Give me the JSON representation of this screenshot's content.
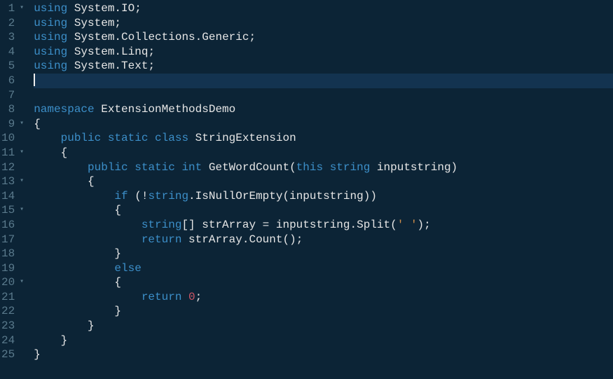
{
  "lines": [
    {
      "n": 1,
      "fold": true,
      "tokens": [
        [
          "k",
          "using "
        ],
        [
          "ns",
          "System"
        ],
        [
          "pn",
          "."
        ],
        [
          "ns",
          "IO"
        ],
        [
          "pn",
          ";"
        ]
      ]
    },
    {
      "n": 2,
      "fold": false,
      "tokens": [
        [
          "k",
          "using "
        ],
        [
          "ns",
          "System"
        ],
        [
          "pn",
          ";"
        ]
      ]
    },
    {
      "n": 3,
      "fold": false,
      "tokens": [
        [
          "k",
          "using "
        ],
        [
          "ns",
          "System"
        ],
        [
          "pn",
          "."
        ],
        [
          "ns",
          "Collections"
        ],
        [
          "pn",
          "."
        ],
        [
          "ns",
          "Generic"
        ],
        [
          "pn",
          ";"
        ]
      ]
    },
    {
      "n": 4,
      "fold": false,
      "tokens": [
        [
          "k",
          "using "
        ],
        [
          "ns",
          "System"
        ],
        [
          "pn",
          "."
        ],
        [
          "ns",
          "Linq"
        ],
        [
          "pn",
          ";"
        ]
      ]
    },
    {
      "n": 5,
      "fold": false,
      "tokens": [
        [
          "k",
          "using "
        ],
        [
          "ns",
          "System"
        ],
        [
          "pn",
          "."
        ],
        [
          "ns",
          "Text"
        ],
        [
          "pn",
          ";"
        ]
      ]
    },
    {
      "n": 6,
      "fold": false,
      "current": true,
      "cursor": true,
      "tokens": []
    },
    {
      "n": 7,
      "fold": false,
      "tokens": []
    },
    {
      "n": 8,
      "fold": false,
      "tokens": [
        [
          "k",
          "namespace "
        ],
        [
          "cl",
          "ExtensionMethodsDemo"
        ]
      ]
    },
    {
      "n": 9,
      "fold": true,
      "tokens": [
        [
          "pn",
          "{"
        ]
      ]
    },
    {
      "n": 10,
      "fold": false,
      "indent": 1,
      "tokens": [
        [
          "k",
          "public "
        ],
        [
          "k",
          "static "
        ],
        [
          "k",
          "class "
        ],
        [
          "cl",
          "StringExtension"
        ]
      ]
    },
    {
      "n": 11,
      "fold": true,
      "indent": 1,
      "tokens": [
        [
          "pn",
          "{"
        ]
      ]
    },
    {
      "n": 12,
      "fold": false,
      "indent": 2,
      "tokens": [
        [
          "k",
          "public "
        ],
        [
          "k",
          "static "
        ],
        [
          "ty",
          "int "
        ],
        [
          "fn",
          "GetWordCount"
        ],
        [
          "pn",
          "("
        ],
        [
          "k",
          "this "
        ],
        [
          "ty",
          "string "
        ],
        [
          "id",
          "inputstring"
        ],
        [
          "pn",
          ")"
        ]
      ]
    },
    {
      "n": 13,
      "fold": true,
      "indent": 2,
      "tokens": [
        [
          "pn",
          "{"
        ]
      ]
    },
    {
      "n": 14,
      "fold": false,
      "indent": 3,
      "tokens": [
        [
          "k",
          "if "
        ],
        [
          "pn",
          "(!"
        ],
        [
          "ty",
          "string"
        ],
        [
          "pn",
          "."
        ],
        [
          "fn",
          "IsNullOrEmpty"
        ],
        [
          "pn",
          "("
        ],
        [
          "id",
          "inputstring"
        ],
        [
          "pn",
          "))"
        ]
      ]
    },
    {
      "n": 15,
      "fold": true,
      "indent": 3,
      "tokens": [
        [
          "pn",
          "{"
        ]
      ]
    },
    {
      "n": 16,
      "fold": false,
      "indent": 4,
      "tokens": [
        [
          "ty",
          "string"
        ],
        [
          "pn",
          "[] "
        ],
        [
          "id",
          "strArray"
        ],
        [
          "op",
          " = "
        ],
        [
          "id",
          "inputstring"
        ],
        [
          "pn",
          "."
        ],
        [
          "fn",
          "Split"
        ],
        [
          "pn",
          "("
        ],
        [
          "str",
          "' '"
        ],
        [
          "pn",
          ");"
        ]
      ]
    },
    {
      "n": 17,
      "fold": false,
      "indent": 4,
      "tokens": [
        [
          "k",
          "return "
        ],
        [
          "id",
          "strArray"
        ],
        [
          "pn",
          "."
        ],
        [
          "fn",
          "Count"
        ],
        [
          "pn",
          "();"
        ]
      ]
    },
    {
      "n": 18,
      "fold": false,
      "indent": 3,
      "tokens": [
        [
          "pn",
          "}"
        ]
      ]
    },
    {
      "n": 19,
      "fold": false,
      "indent": 3,
      "tokens": [
        [
          "k",
          "else"
        ]
      ]
    },
    {
      "n": 20,
      "fold": true,
      "indent": 3,
      "tokens": [
        [
          "pn",
          "{"
        ]
      ]
    },
    {
      "n": 21,
      "fold": false,
      "indent": 4,
      "tokens": [
        [
          "k",
          "return "
        ],
        [
          "num",
          "0"
        ],
        [
          "pn",
          ";"
        ]
      ]
    },
    {
      "n": 22,
      "fold": false,
      "indent": 3,
      "tokens": [
        [
          "pn",
          "}"
        ]
      ]
    },
    {
      "n": 23,
      "fold": false,
      "indent": 2,
      "tokens": [
        [
          "pn",
          "}"
        ]
      ]
    },
    {
      "n": 24,
      "fold": false,
      "indent": 1,
      "tokens": [
        [
          "pn",
          "}"
        ]
      ]
    },
    {
      "n": 25,
      "fold": false,
      "tokens": [
        [
          "pn",
          "}"
        ]
      ]
    }
  ],
  "indent_unit": "    ",
  "fold_glyph": "▾"
}
